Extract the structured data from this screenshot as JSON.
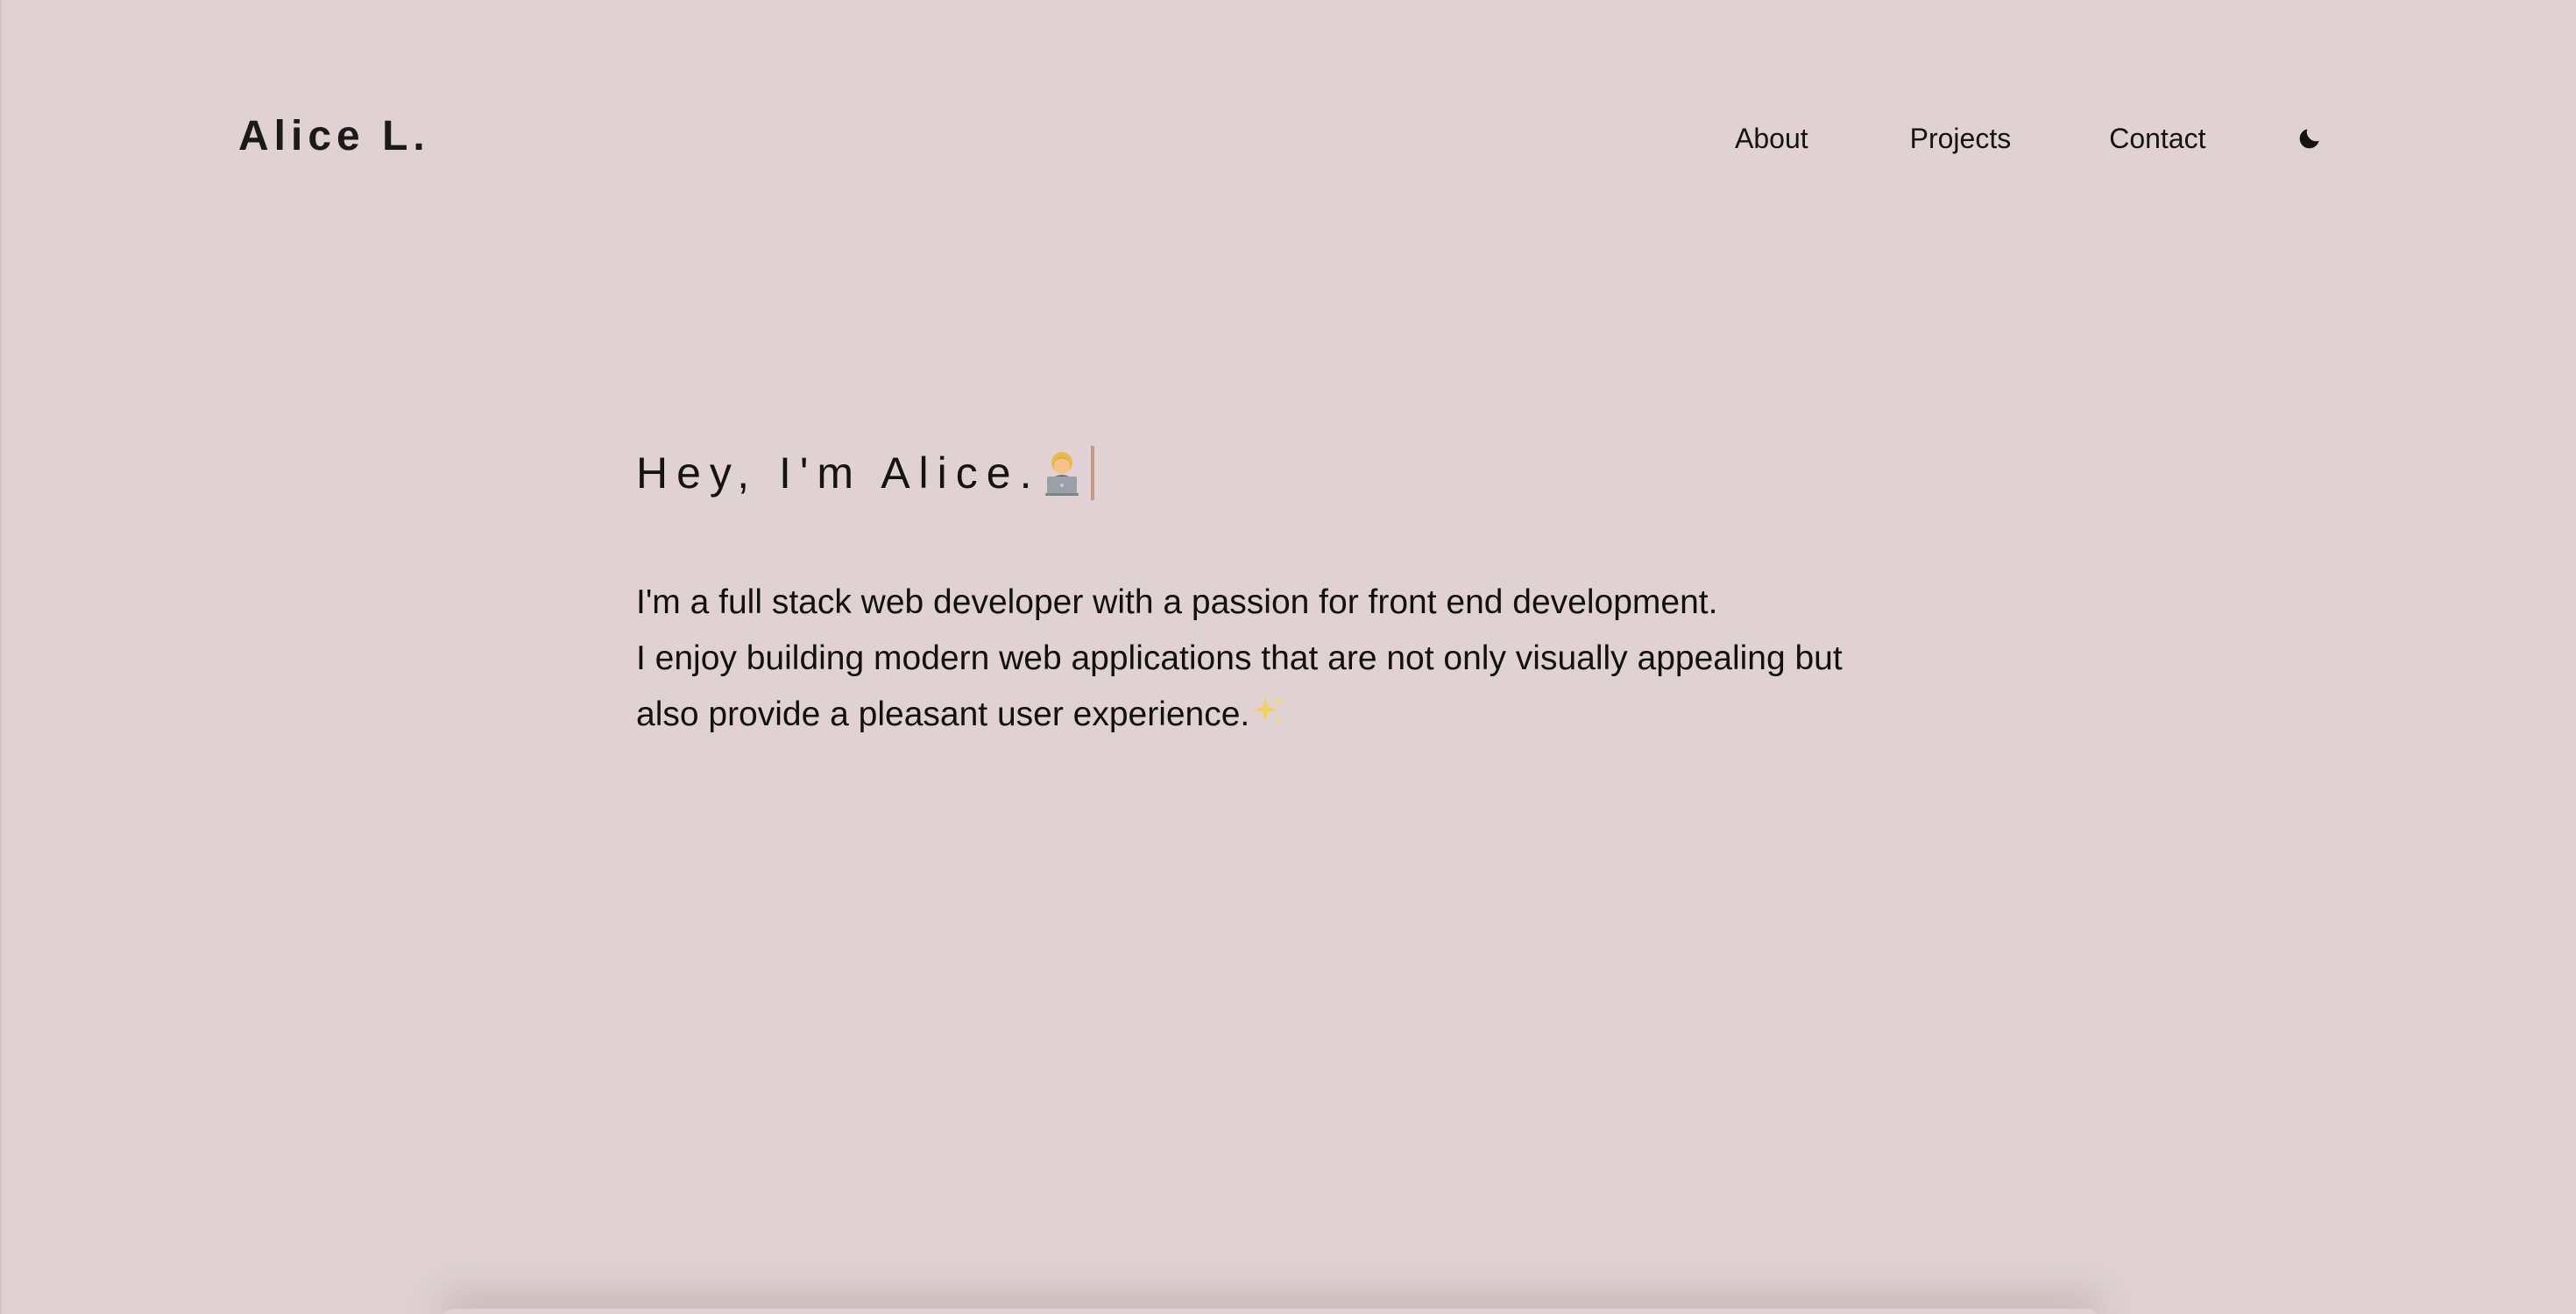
{
  "colors": {
    "background": "#e0d2d2",
    "text": "#111111",
    "caret": "#c49a86"
  },
  "header": {
    "logo": "Alice L.",
    "nav": {
      "about": "About",
      "projects": "Projects",
      "contact": "Contact"
    },
    "theme_toggle_icon": "moon-icon"
  },
  "hero": {
    "greeting": "Hey, I'm Alice.",
    "greeting_icon": "woman-technologist-emoji",
    "bio_lines": [
      "I'm a full stack web developer with a passion for front end development.",
      "I enjoy building modern web applications that are not only visually appealing but",
      "also provide a pleasant user experience."
    ],
    "bio_icon": "sparkles-emoji"
  }
}
